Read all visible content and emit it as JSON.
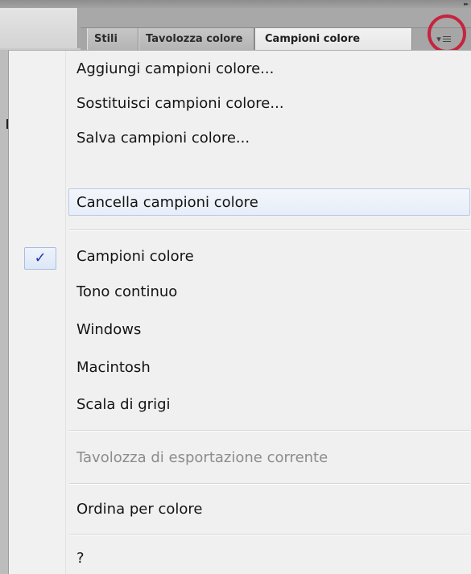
{
  "tabs": [
    {
      "label": "Stili"
    },
    {
      "label": "Tavolozza colore"
    },
    {
      "label": "Campioni colore"
    }
  ],
  "panel_menu_glyph": "▾",
  "menu": {
    "items": [
      {
        "label": "Aggiungi campioni colore..."
      },
      {
        "label": "Sostituisci campioni colore..."
      },
      {
        "label": "Salva campioni colore..."
      },
      {
        "label": "Cancella campioni colore"
      },
      {
        "label": "Campioni colore"
      },
      {
        "label": "Tono continuo"
      },
      {
        "label": "Windows"
      },
      {
        "label": "Macintosh"
      },
      {
        "label": "Scala di grigi"
      },
      {
        "label": "Tavolozza di esportazione corrente"
      },
      {
        "label": "Ordina per colore"
      },
      {
        "label": "?"
      }
    ],
    "check_glyph": "✓"
  },
  "colors": {
    "highlight_ring": "#c5243f",
    "check": "#1a3aa8",
    "hover_border": "#b9cbe6",
    "disabled_text": "#8c8c8c"
  }
}
